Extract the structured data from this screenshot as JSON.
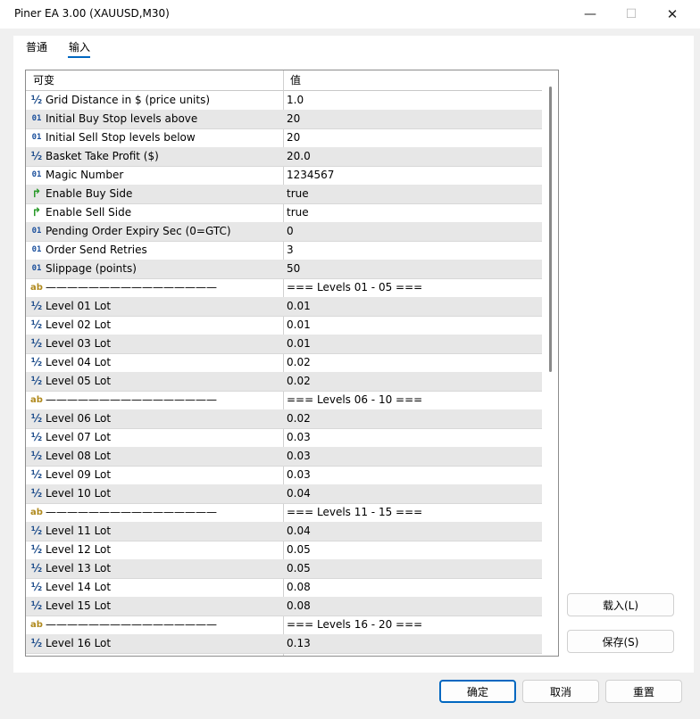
{
  "window": {
    "title": "Piner EA 3.00 (XAUUSD,M30)",
    "minimize_glyph": "—",
    "maximize_glyph": "☐",
    "close_glyph": "✕"
  },
  "tabs": [
    {
      "label": "普通",
      "active": false
    },
    {
      "label": "输入",
      "active": true
    }
  ],
  "grid": {
    "columns": [
      "可变",
      "值"
    ],
    "rows": [
      {
        "type": "double",
        "name": "Grid Distance in $ (price units)",
        "value": "1.0"
      },
      {
        "type": "int",
        "name": "Initial Buy Stop levels above",
        "value": "20"
      },
      {
        "type": "int",
        "name": "Initial Sell Stop levels below",
        "value": "20"
      },
      {
        "type": "double",
        "name": "Basket Take Profit ($)",
        "value": "20.0"
      },
      {
        "type": "int",
        "name": "Magic Number",
        "value": "1234567"
      },
      {
        "type": "bool",
        "name": "Enable Buy Side",
        "value": "true"
      },
      {
        "type": "bool",
        "name": "Enable Sell Side",
        "value": "true"
      },
      {
        "type": "int",
        "name": "Pending Order Expiry Sec (0=GTC)",
        "value": "0"
      },
      {
        "type": "int",
        "name": "Order Send Retries",
        "value": "3"
      },
      {
        "type": "int",
        "name": "Slippage (points)",
        "value": "50"
      },
      {
        "type": "string",
        "name": "————————————————",
        "value": "=== Levels 01 - 05 ==="
      },
      {
        "type": "double",
        "name": "Level 01 Lot",
        "value": "0.01"
      },
      {
        "type": "double",
        "name": "Level 02 Lot",
        "value": "0.01"
      },
      {
        "type": "double",
        "name": "Level 03 Lot",
        "value": "0.01"
      },
      {
        "type": "double",
        "name": "Level 04 Lot",
        "value": "0.02"
      },
      {
        "type": "double",
        "name": "Level 05 Lot",
        "value": "0.02"
      },
      {
        "type": "string",
        "name": "————————————————",
        "value": "=== Levels 06 - 10 ==="
      },
      {
        "type": "double",
        "name": "Level 06 Lot",
        "value": "0.02"
      },
      {
        "type": "double",
        "name": "Level 07 Lot",
        "value": "0.03"
      },
      {
        "type": "double",
        "name": "Level 08 Lot",
        "value": "0.03"
      },
      {
        "type": "double",
        "name": "Level 09 Lot",
        "value": "0.03"
      },
      {
        "type": "double",
        "name": "Level 10 Lot",
        "value": "0.04"
      },
      {
        "type": "string",
        "name": "————————————————",
        "value": "=== Levels 11 - 15 ==="
      },
      {
        "type": "double",
        "name": "Level 11 Lot",
        "value": "0.04"
      },
      {
        "type": "double",
        "name": "Level 12 Lot",
        "value": "0.05"
      },
      {
        "type": "double",
        "name": "Level 13 Lot",
        "value": "0.05"
      },
      {
        "type": "double",
        "name": "Level 14 Lot",
        "value": "0.08"
      },
      {
        "type": "double",
        "name": "Level 15 Lot",
        "value": "0.08"
      },
      {
        "type": "string",
        "name": "————————————————",
        "value": "=== Levels 16 - 20 ==="
      },
      {
        "type": "double",
        "name": "Level 16 Lot",
        "value": "0.13"
      }
    ]
  },
  "icons": {
    "double": {
      "glyph": "½",
      "name": "double-type-icon"
    },
    "int": {
      "glyph": "01",
      "name": "integer-type-icon"
    },
    "bool": {
      "glyph": "↱",
      "name": "bool-type-icon"
    },
    "string": {
      "glyph": "ab",
      "name": "string-type-icon"
    }
  },
  "buttons": {
    "load": "载入(L)",
    "save": "保存(S)",
    "ok": "确定",
    "cancel": "取消",
    "reset": "重置"
  },
  "colors": {
    "accent": "#0067c0",
    "alt_row": "#e7e7e7"
  }
}
